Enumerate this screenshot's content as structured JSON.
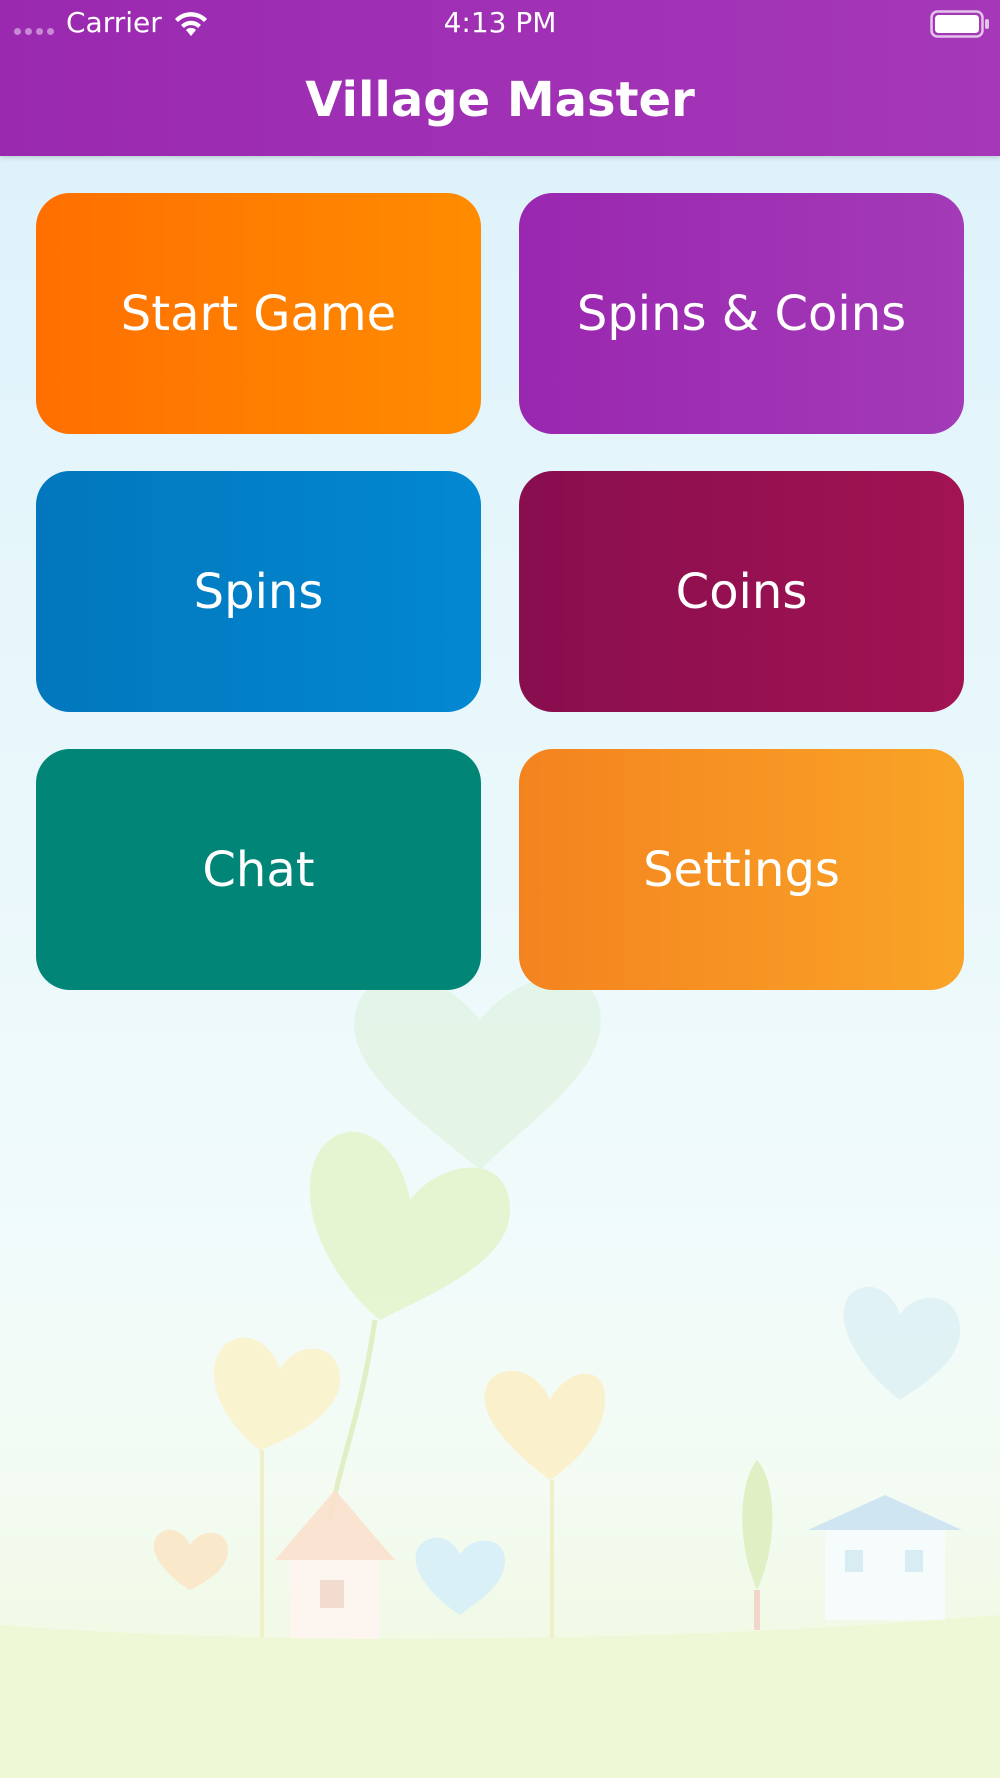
{
  "status_bar": {
    "carrier": "Carrier",
    "time": "4:13 PM"
  },
  "header": {
    "title": "Village Master"
  },
  "menu": {
    "tiles": [
      {
        "label": "Start Game",
        "color": "#ff7a00"
      },
      {
        "label": "Spins & Coins",
        "color": "#9f30b4"
      },
      {
        "label": "Spins",
        "color": "#0280c8"
      },
      {
        "label": "Coins",
        "color": "#95104f"
      },
      {
        "label": "Chat",
        "color": "#008577"
      },
      {
        "label": "Settings",
        "color": "#f69424"
      }
    ]
  },
  "icons": [
    "signal-dots-icon",
    "wifi-icon",
    "battery-icon"
  ],
  "colors": {
    "header_bg": "#a030b5",
    "background": "#e6f6fb"
  }
}
